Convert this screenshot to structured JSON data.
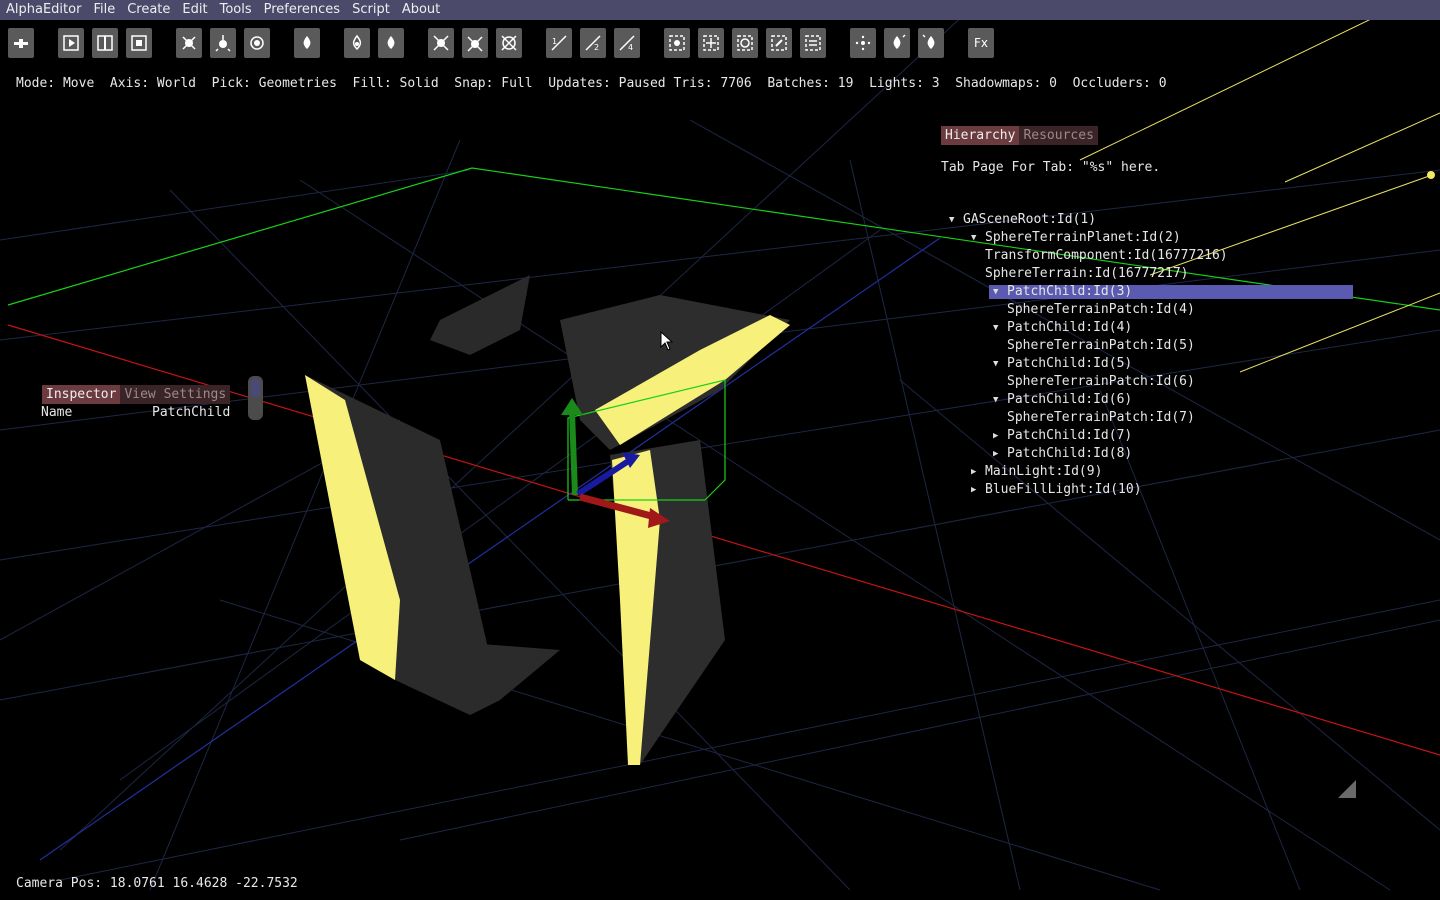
{
  "menu": [
    "AlphaEditor",
    "File",
    "Create",
    "Edit",
    "Tools",
    "Preferences",
    "Script",
    "About"
  ],
  "toolbar": {
    "buttons": [
      {
        "icon": "snap-move-icon"
      },
      {
        "icon": "play-icon"
      },
      {
        "icon": "pause-split-icon"
      },
      {
        "icon": "frame-icon"
      },
      {
        "icon": "node-icon"
      },
      {
        "icon": "node-up-icon"
      },
      {
        "icon": "node-circle-icon"
      },
      {
        "icon": "drop-icon"
      },
      {
        "icon": "drop-up-icon"
      },
      {
        "icon": "drop-full-icon"
      },
      {
        "icon": "cross-node-icon"
      },
      {
        "icon": "cross-node-up-icon"
      },
      {
        "icon": "cross-node-circle-icon"
      },
      {
        "icon": "axis-1-icon"
      },
      {
        "icon": "axis-2-icon"
      },
      {
        "icon": "axis-4-icon"
      },
      {
        "icon": "select-box-icon"
      },
      {
        "icon": "select-grid-icon"
      },
      {
        "icon": "select-circle-icon"
      },
      {
        "icon": "select-pen-icon"
      },
      {
        "icon": "select-stack-icon"
      },
      {
        "icon": "dots-target-icon"
      },
      {
        "icon": "light-icon"
      },
      {
        "icon": "light-fill-icon"
      },
      {
        "icon": "fx-icon",
        "label": "Fx"
      }
    ]
  },
  "status": {
    "text": "Mode: Move  Axis: World  Pick: Geometries  Fill: Solid  Snap: Full  Updates: Paused Tris: 7706  Batches: 19  Lights: 3  Shadowmaps: 0  Occluders: 0"
  },
  "hierarchy": {
    "tabs": [
      "Hierarchy",
      "Resources"
    ],
    "note": "Tab Page For Tab: \"%s\" here.",
    "nodes": [
      {
        "label": "GASceneRoot:Id(1)",
        "indent": 0,
        "arrow": "down"
      },
      {
        "label": "SphereTerrainPlanet:Id(2)",
        "indent": 1,
        "arrow": "down"
      },
      {
        "label": "TransformComponent:Id(16777216)",
        "indent": 1,
        "arrow": "none"
      },
      {
        "label": "SphereTerrain:Id(16777217)",
        "indent": 1,
        "arrow": "none"
      },
      {
        "label": "PatchChild:Id(3)",
        "indent": 2,
        "arrow": "down",
        "selected": true
      },
      {
        "label": "SphereTerrainPatch:Id(4)",
        "indent": 2,
        "arrow": "none"
      },
      {
        "label": "PatchChild:Id(4)",
        "indent": 2,
        "arrow": "down"
      },
      {
        "label": "SphereTerrainPatch:Id(5)",
        "indent": 2,
        "arrow": "none"
      },
      {
        "label": "PatchChild:Id(5)",
        "indent": 2,
        "arrow": "down"
      },
      {
        "label": "SphereTerrainPatch:Id(6)",
        "indent": 2,
        "arrow": "none"
      },
      {
        "label": "PatchChild:Id(6)",
        "indent": 2,
        "arrow": "down"
      },
      {
        "label": "SphereTerrainPatch:Id(7)",
        "indent": 2,
        "arrow": "none"
      },
      {
        "label": "PatchChild:Id(7)",
        "indent": 2,
        "arrow": "right"
      },
      {
        "label": "PatchChild:Id(8)",
        "indent": 2,
        "arrow": "right"
      },
      {
        "label": "MainLight:Id(9)",
        "indent": 1,
        "arrow": "right"
      },
      {
        "label": "BlueFillLight:Id(10)",
        "indent": 1,
        "arrow": "right"
      }
    ]
  },
  "inspector": {
    "tabs": [
      "Inspector",
      "View Settings"
    ],
    "field_name": "Name",
    "field_value": "PatchChild"
  },
  "camera": {
    "text": "Camera Pos: 18.0761 16.4628 -22.7532"
  },
  "colors": {
    "menubar": "#4b4a6b",
    "grid": "#1c2540",
    "axis_x": "#c41414",
    "axis_z": "#2030a0",
    "bounds": "#18d018",
    "terrain_lit": "#f7f07a",
    "terrain_dark": "#2b2b2b",
    "selection": "#5a5ab0"
  }
}
